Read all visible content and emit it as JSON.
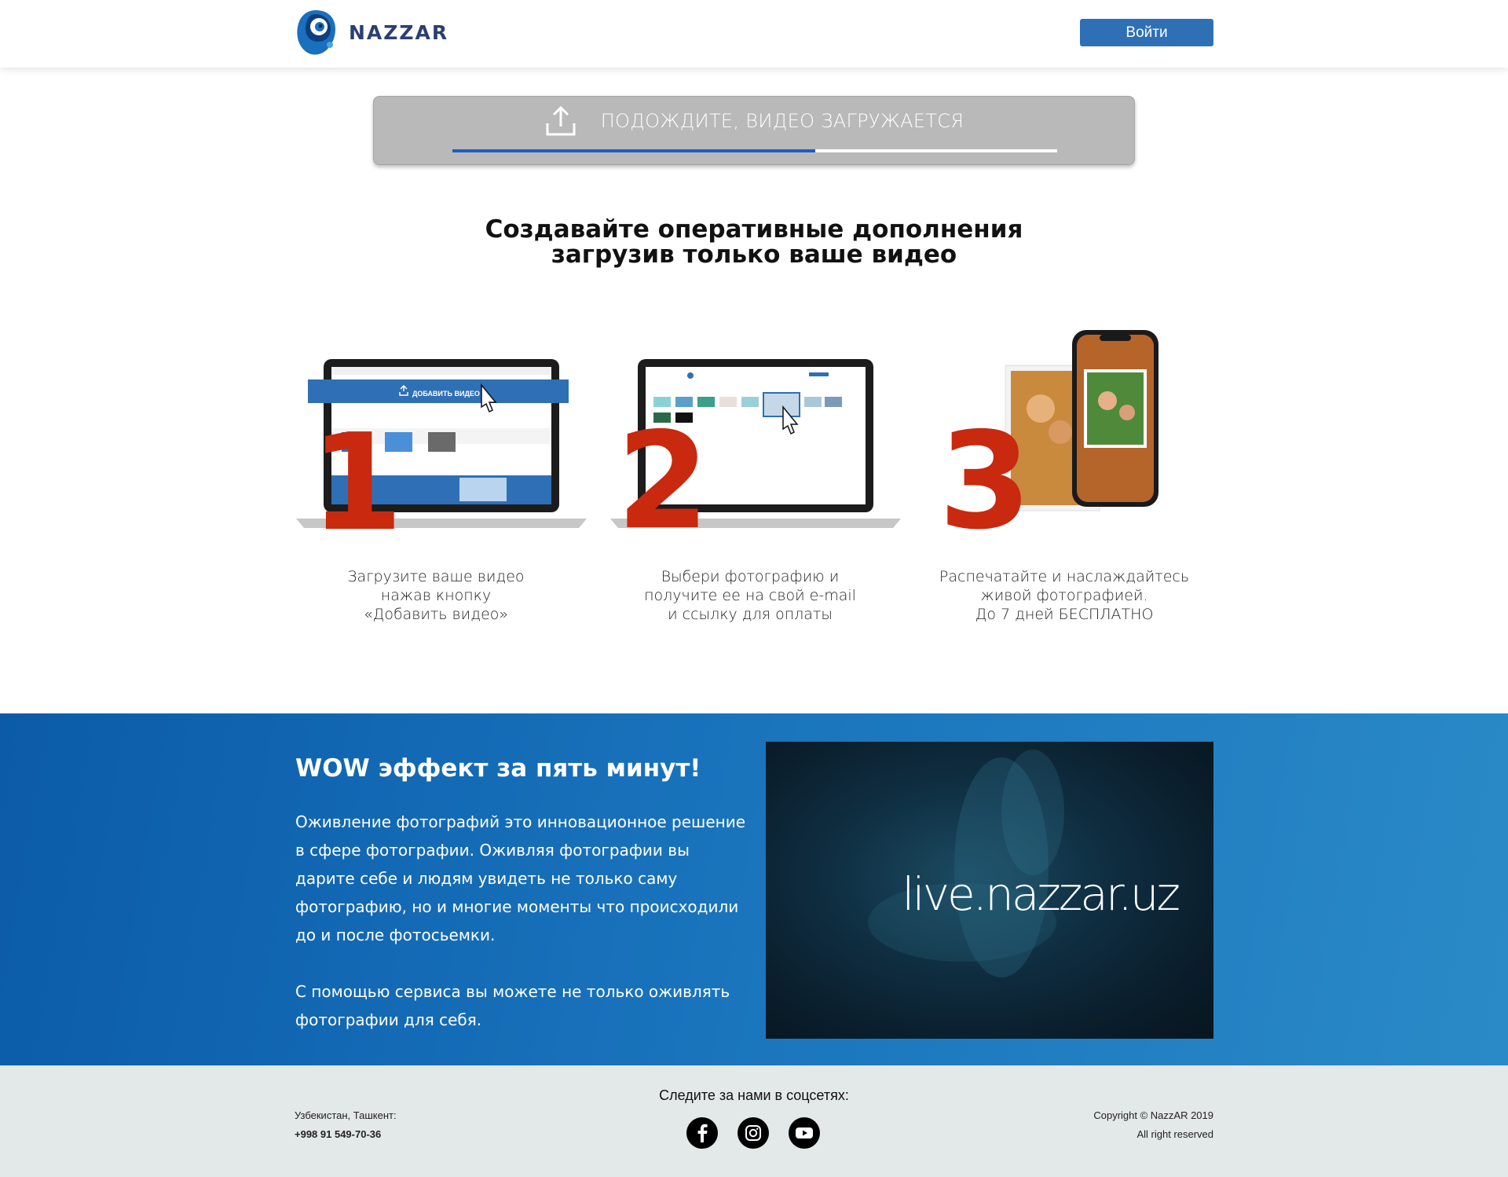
{
  "header": {
    "brand": "NAZZAR",
    "login_label": "Войти"
  },
  "upload": {
    "label": "ПОДОЖДИТЕ, ВИДЕО ЗАГРУЖАЕТСЯ",
    "progress": 0.6
  },
  "main": {
    "heading_line1": "Создавайте оперативные дополнения",
    "heading_line2": "загрузив только ваше видео"
  },
  "steps": [
    {
      "number": "1",
      "caption": [
        "Загрузите ваше видео",
        "нажав кнопку",
        "«Добавить видео»"
      ],
      "screen_button": "ДОБАВИТЬ ВИДЕО"
    },
    {
      "number": "2",
      "caption": [
        "Выбери фотографию и",
        "получите ее на свой e-mail",
        "и ссылку для оплаты"
      ]
    },
    {
      "number": "3",
      "caption": [
        "Распечатайте и наслаждайтесь",
        "живой фотографией.",
        "До 7 дней БЕСПЛАТНО"
      ]
    }
  ],
  "wow": {
    "title": "WOW эффект за пять минут!",
    "paragraph1": "Оживление фотографий это инновационное решение в сфере фотографии. Оживляя фотографии вы дарите себе и людям увидеть не только саму фотографию, но и многие моменты что происходили до  и после фотосьемки.",
    "paragraph2": "С помощью сервиса вы можете не только оживлять фотографии для себя.",
    "video_text": "live.nazzar.uz"
  },
  "footer": {
    "location": "Узбекистан, Ташкент:",
    "phone": "+998 91 549-70-36",
    "follow_label": "Следите за нами в соцсетях:",
    "copyright": "Copyright © NazzAR 2019",
    "rights": "All right reserved",
    "social_icons": [
      "facebook-icon",
      "instagram-icon",
      "youtube-icon"
    ]
  },
  "colors": {
    "accent": "#2f6fb5",
    "progress": "#1f5dc9",
    "step_number": "#c8290f",
    "footer_bg": "#e3e8e8"
  }
}
